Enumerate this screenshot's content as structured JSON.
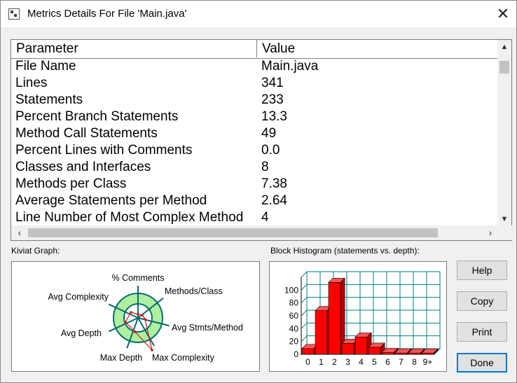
{
  "window": {
    "title": "Metrics Details For File 'Main.java'",
    "close_glyph": "✕"
  },
  "table": {
    "headers": {
      "parameter": "Parameter",
      "value": "Value"
    },
    "rows": [
      {
        "parameter": "File Name",
        "value": "Main.java"
      },
      {
        "parameter": "Lines",
        "value": "341"
      },
      {
        "parameter": "Statements",
        "value": "233"
      },
      {
        "parameter": "Percent Branch Statements",
        "value": "13.3"
      },
      {
        "parameter": "Method Call Statements",
        "value": "49"
      },
      {
        "parameter": "Percent Lines with Comments",
        "value": "0.0"
      },
      {
        "parameter": "Classes and Interfaces",
        "value": "8"
      },
      {
        "parameter": "Methods per Class",
        "value": "7.38"
      },
      {
        "parameter": "Average Statements per Method",
        "value": "2.64"
      },
      {
        "parameter": "Line Number of Most Complex Method",
        "value": "4"
      }
    ]
  },
  "kiviat": {
    "label": "Kiviat Graph:",
    "axes": [
      "% Comments",
      "Methods/Class",
      "Avg Stmts/Method",
      "Max Complexity",
      "Max Depth",
      "Avg Depth",
      "Avg Complexity"
    ]
  },
  "histogram": {
    "label": "Block Histogram (statements vs. depth):",
    "categories": [
      "0",
      "1",
      "2",
      "3",
      "4",
      "5",
      "6",
      "7",
      "8",
      "9+"
    ],
    "values": [
      9,
      68,
      112,
      17,
      27,
      11,
      3,
      2,
      2,
      2
    ],
    "yticks": [
      "0",
      "20",
      "40",
      "60",
      "80",
      "100"
    ],
    "ylim": [
      0,
      120
    ],
    "bar_color": "#ff0000",
    "grid_color": "#008080"
  },
  "buttons": {
    "help": "Help",
    "copy": "Copy",
    "print": "Print",
    "done": "Done"
  }
}
